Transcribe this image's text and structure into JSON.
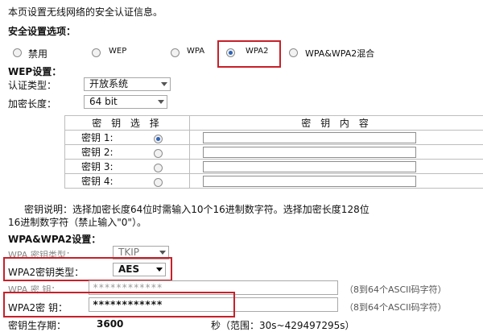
{
  "intro": "本页设置无线网络的安全认证信息。",
  "security_options": {
    "title": "安全设置选项：",
    "options": [
      {
        "label": "禁用",
        "selected": false
      },
      {
        "label": "WEP",
        "selected": false
      },
      {
        "label": "WPA",
        "selected": false
      },
      {
        "label": "WPA2",
        "selected": true
      },
      {
        "label": "WPA&WPA2混合",
        "selected": false
      }
    ]
  },
  "wep": {
    "title": "WEP设置：",
    "auth_label": "认证类型：",
    "auth_value": "开放系统",
    "length_label": "加密长度：",
    "length_value": "64 bit",
    "table": {
      "col_select": "密 钥 选 择",
      "col_content": "密 钥 内 容",
      "rows": [
        {
          "label": "密钥 1:",
          "selected": true
        },
        {
          "label": "密钥 2:",
          "selected": false
        },
        {
          "label": "密钥 3:",
          "selected": false
        },
        {
          "label": "密钥 4:",
          "selected": false
        }
      ]
    },
    "note_line1": "密钥说明：选择加密长度64位时需输入10个16进制数字符。选择加密长度128位",
    "note_line2": "16进制数字符（禁止输入\"0\"）。"
  },
  "wpa": {
    "title": "WPA&WPA2设置：",
    "wpa_type_label": "WPA 密钥类型：",
    "wpa_type_value": "TKIP",
    "wpa2_type_label": "WPA2密钥类型：",
    "wpa2_type_value": "AES",
    "wpa_key_label": "WPA 密  钥：",
    "wpa_key_value": "************",
    "wpa_key_hint": "（8到64个ASCII码字符）",
    "wpa2_key_label": "WPA2密  钥：",
    "wpa2_key_value": "************",
    "wpa2_key_hint": "（8到64个ASCII码字符）",
    "lifetime_label": "密钥生存期：",
    "lifetime_value": "3600",
    "lifetime_hint": "秒（范围：30s~429497295s）"
  },
  "colors": {
    "highlight": "#c8202a",
    "radio_selected": "#2a63b8"
  }
}
